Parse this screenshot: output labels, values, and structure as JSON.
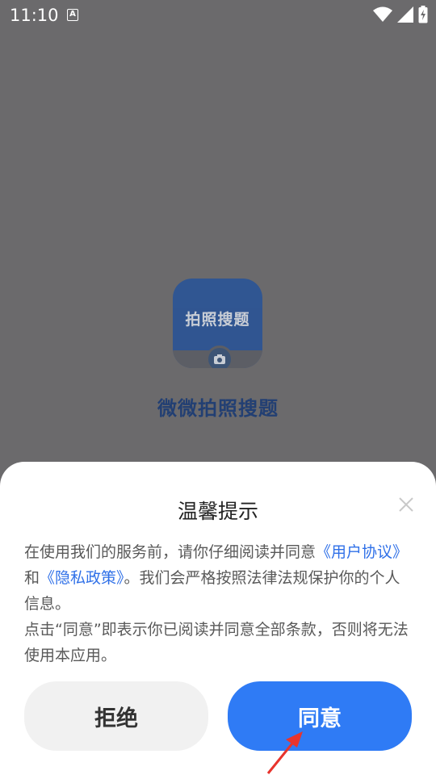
{
  "status_bar": {
    "time": "11:10",
    "notification_icon_letter": "A",
    "icons": [
      "wifi-icon",
      "signal-icon",
      "battery-icon"
    ]
  },
  "splash": {
    "icon_text": "拍照搜题",
    "app_name": "微微拍照搜题"
  },
  "dialog": {
    "title": "温馨提示",
    "body": {
      "p1_before": "在使用我们的服务前，请你仔细阅读并同意",
      "user_agreement_link": "《用户协议》",
      "and_text": "和",
      "privacy_policy_link": "《隐私政策》",
      "p1_after": "。我们会严格按照法律法规保护你的个人信息。",
      "p2": "点击“同意”即表示你已阅读并同意全部条款，否则将无法使用本应用。"
    },
    "refuse_label": "拒绝",
    "agree_label": "同意"
  },
  "colors": {
    "accent": "#2f7bf5",
    "link": "#2f70e8",
    "overlay": "#6b6a6c"
  }
}
